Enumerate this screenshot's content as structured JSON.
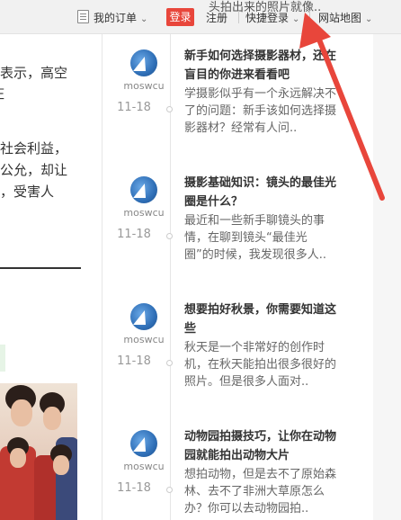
{
  "topbar": {
    "overlay_text": "头拍出来的照片就像..",
    "my_orders": "我的订单",
    "login": "登录",
    "register": "注册",
    "quick_login": "快捷登录",
    "site_map": "网站地图",
    "chevron": "⌄"
  },
  "article_fragment": {
    "lines": [
      "表示，高空",
      "庄",
      "社会利益，",
      "公允，却让",
      "，受害人"
    ]
  },
  "timeline": {
    "items": [
      {
        "author": "moswcu",
        "date": "11-18",
        "title_lines": [
          "新手如何选择摄影器材，还在",
          "盲目的你进来看看吧"
        ],
        "desc_lines": [
          "学摄影似乎有一个永远解决不",
          "了的问题：新手该如何选择摄",
          "影器材？经常有人问.."
        ]
      },
      {
        "author": "moswcu",
        "date": "11-18",
        "title_lines": [
          "摄影基础知识：镜头的最佳光",
          "圈是什么？"
        ],
        "desc_lines": [
          "最近和一些新手聊镜头的事",
          "情，在聊到镜头“最佳光",
          "圈”的时候，我发现很多人.."
        ]
      },
      {
        "author": "moswcu",
        "date": "11-18",
        "title_lines": [
          "想要拍好秋景，你需要知道这",
          "些"
        ],
        "desc_lines": [
          "秋天是一个非常好的创作时",
          "机，在秋天能拍出很多很好的",
          "照片。但是很多人面对.."
        ]
      },
      {
        "author": "moswcu",
        "date": "11-18",
        "title_lines": [
          "动物园拍摄技巧，让你在动物",
          "园就能拍出动物大片"
        ],
        "desc_lines": [
          "想拍动物，但是去不了原始森",
          "林、去不了非洲大草原怎么",
          "办？你可以去动物园拍.."
        ]
      }
    ]
  },
  "colors": {
    "login_bg": "#e8463b",
    "arrow": "#e8463b",
    "topbar_bg": "#f1f1f1"
  },
  "icons": [
    "orders-icon",
    "chevron-down-icon",
    "avatar",
    "timeline-dot",
    "annotation-arrow"
  ]
}
